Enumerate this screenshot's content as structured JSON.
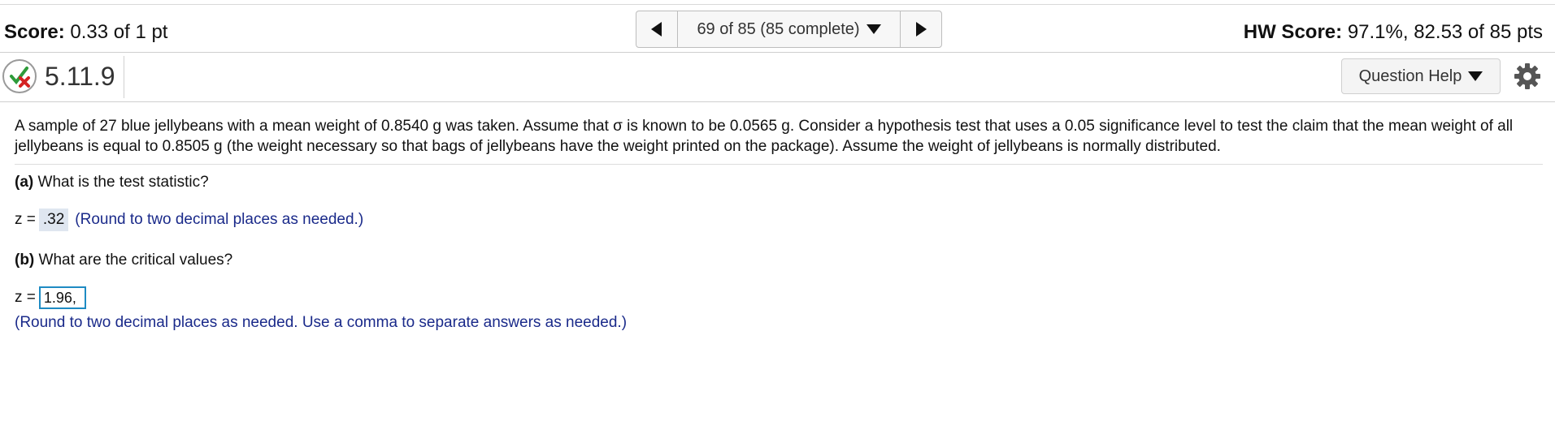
{
  "scorebar": {
    "score_label": "Score:",
    "score_value": "0.33 of 1 pt",
    "nav_position": "69 of 85 (85 complete)",
    "hw_label": "HW Score:",
    "hw_value": "97.1%, 82.53 of 85 pts"
  },
  "question": {
    "number": "5.11.9",
    "help_label": "Question Help",
    "status": "partially-correct",
    "stem": "A sample of 27 blue jellybeans with a mean weight of 0.8540 g was taken. Assume that σ is known to be 0.0565 g. Consider a hypothesis test that uses a 0.05 significance level to test the claim that the mean weight of all jellybeans is equal to 0.8505 g (the weight necessary so that bags of jellybeans have the weight printed on the package). Assume the weight of jellybeans is normally distributed."
  },
  "parts": {
    "a": {
      "label": "(a)",
      "question": "What is the test statistic?",
      "var": "z =",
      "answer": ".32",
      "hint": "(Round to two decimal places as needed.)"
    },
    "b": {
      "label": "(b)",
      "question": "What are the critical values?",
      "var": "z =",
      "input_value": "1.96,",
      "hint": "(Round to two decimal places as needed. Use a comma to separate answers as needed.)"
    }
  },
  "colors": {
    "hint_blue": "#1a2a8a",
    "input_border": "#1e8bc3",
    "check_green": "#2e9b3a",
    "cross_red": "#d42222"
  },
  "icons": [
    "arrow-left-icon",
    "arrow-right-icon",
    "caret-down-icon",
    "status-partial-icon",
    "gear-icon"
  ]
}
